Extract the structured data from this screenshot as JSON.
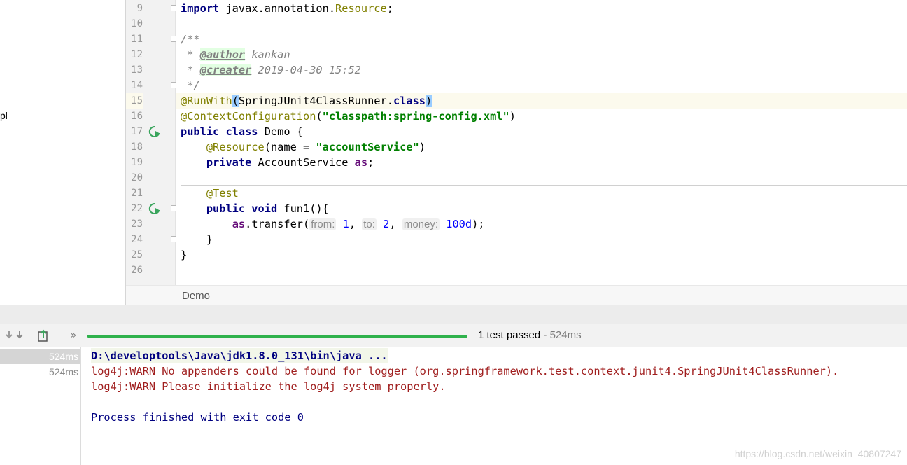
{
  "project_tree": {
    "fragment": "pl"
  },
  "gutter": {
    "lines": [
      "9",
      "10",
      "11",
      "12",
      "13",
      "14",
      "15",
      "16",
      "17",
      "18",
      "19",
      "20",
      "21",
      "22",
      "23",
      "24",
      "25",
      "26"
    ]
  },
  "code": {
    "l9_kw": "import",
    "l9_pkg": " javax.annotation.",
    "l9_cls": "Resource",
    "l9_end": ";",
    "l11": "/**",
    "l12_pre": " * ",
    "l12_tag": "@author",
    "l12_val": " kankan",
    "l13_pre": " * ",
    "l13_tag": "@creater",
    "l13_val": " 2019-04-30 15:52",
    "l14": " */",
    "l15_ann": "@RunWith",
    "l15_open": "(",
    "l15_cls": "SpringJUnit4ClassRunner.",
    "l15_kw": "class",
    "l15_close": ")",
    "l16_ann": "@ContextConfiguration",
    "l16_open": "(",
    "l16_str": "\"classpath:spring-config.xml\"",
    "l16_close": ")",
    "l17_kw": "public class",
    "l17_rest": " Demo {",
    "l18_indent": "    ",
    "l18_ann": "@Resource",
    "l18_mid": "(name = ",
    "l18_str": "\"accountService\"",
    "l18_end": ")",
    "l19_indent": "    ",
    "l19_kw": "private",
    "l19_mid": " AccountService ",
    "l19_fld": "as",
    "l19_end": ";",
    "l21_indent": "    ",
    "l21_ann": "@Test",
    "l22_indent": "    ",
    "l22_kw": "public void",
    "l22_rest": " fun1(){",
    "l23_indent": "        ",
    "l23_fld": "as",
    "l23_call": ".transfer(",
    "l23_h1": "from:",
    "l23_v1": "1",
    "l23_c1": ",",
    "l23_h2": "to:",
    "l23_v2": "2",
    "l23_c2": ",",
    "l23_h3": "money:",
    "l23_v3": "100d",
    "l23_end": ");",
    "l24": "    }",
    "l25": "}"
  },
  "breadcrumb": {
    "label": "Demo"
  },
  "run": {
    "status_text": "1 test passed",
    "status_time": " - 524ms",
    "progress": 1.0,
    "accent": "#2fb24c"
  },
  "tests": [
    {
      "time": "524ms",
      "selected": true
    },
    {
      "time": "524ms",
      "selected": false
    }
  ],
  "console": {
    "cmd": "D:\\developtools\\Java\\jdk1.8.0_131\\bin\\java ...",
    "warn1": "log4j:WARN No appenders could be found for logger (org.springframework.test.context.junit4.SpringJUnit4ClassRunner).",
    "warn2": "log4j:WARN Please initialize the log4j system properly.",
    "finish": "Process finished with exit code 0"
  },
  "watermark": "https://blog.csdn.net/weixin_40807247"
}
